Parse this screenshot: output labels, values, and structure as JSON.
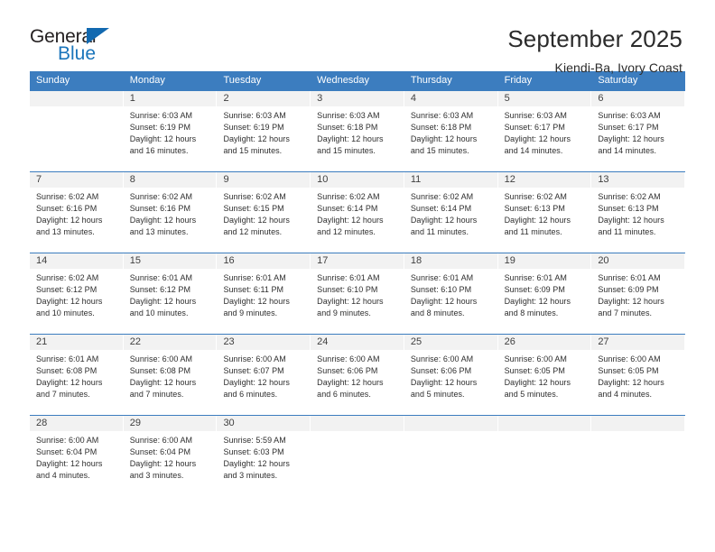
{
  "brand": {
    "name_part1": "General",
    "name_part2": "Blue",
    "triangle_icon": "triangle-icon",
    "accent_color": "#1b75bb"
  },
  "header": {
    "title": "September 2025",
    "subtitle": "Kiendi-Ba, Ivory Coast"
  },
  "theme": {
    "header_row_bg": "#3c7dbf",
    "daynum_band_bg": "#f2f2f2",
    "grid_line": "#3c7dbf",
    "text": "#2e2e2e"
  },
  "calendar": {
    "day_headers": [
      "Sunday",
      "Monday",
      "Tuesday",
      "Wednesday",
      "Thursday",
      "Friday",
      "Saturday"
    ],
    "weeks": [
      [
        {
          "day": "",
          "lines": []
        },
        {
          "day": "1",
          "lines": [
            "Sunrise: 6:03 AM",
            "Sunset: 6:19 PM",
            "Daylight: 12 hours",
            "and 16 minutes."
          ]
        },
        {
          "day": "2",
          "lines": [
            "Sunrise: 6:03 AM",
            "Sunset: 6:19 PM",
            "Daylight: 12 hours",
            "and 15 minutes."
          ]
        },
        {
          "day": "3",
          "lines": [
            "Sunrise: 6:03 AM",
            "Sunset: 6:18 PM",
            "Daylight: 12 hours",
            "and 15 minutes."
          ]
        },
        {
          "day": "4",
          "lines": [
            "Sunrise: 6:03 AM",
            "Sunset: 6:18 PM",
            "Daylight: 12 hours",
            "and 15 minutes."
          ]
        },
        {
          "day": "5",
          "lines": [
            "Sunrise: 6:03 AM",
            "Sunset: 6:17 PM",
            "Daylight: 12 hours",
            "and 14 minutes."
          ]
        },
        {
          "day": "6",
          "lines": [
            "Sunrise: 6:03 AM",
            "Sunset: 6:17 PM",
            "Daylight: 12 hours",
            "and 14 minutes."
          ]
        }
      ],
      [
        {
          "day": "7",
          "lines": [
            "Sunrise: 6:02 AM",
            "Sunset: 6:16 PM",
            "Daylight: 12 hours",
            "and 13 minutes."
          ]
        },
        {
          "day": "8",
          "lines": [
            "Sunrise: 6:02 AM",
            "Sunset: 6:16 PM",
            "Daylight: 12 hours",
            "and 13 minutes."
          ]
        },
        {
          "day": "9",
          "lines": [
            "Sunrise: 6:02 AM",
            "Sunset: 6:15 PM",
            "Daylight: 12 hours",
            "and 12 minutes."
          ]
        },
        {
          "day": "10",
          "lines": [
            "Sunrise: 6:02 AM",
            "Sunset: 6:14 PM",
            "Daylight: 12 hours",
            "and 12 minutes."
          ]
        },
        {
          "day": "11",
          "lines": [
            "Sunrise: 6:02 AM",
            "Sunset: 6:14 PM",
            "Daylight: 12 hours",
            "and 11 minutes."
          ]
        },
        {
          "day": "12",
          "lines": [
            "Sunrise: 6:02 AM",
            "Sunset: 6:13 PM",
            "Daylight: 12 hours",
            "and 11 minutes."
          ]
        },
        {
          "day": "13",
          "lines": [
            "Sunrise: 6:02 AM",
            "Sunset: 6:13 PM",
            "Daylight: 12 hours",
            "and 11 minutes."
          ]
        }
      ],
      [
        {
          "day": "14",
          "lines": [
            "Sunrise: 6:02 AM",
            "Sunset: 6:12 PM",
            "Daylight: 12 hours",
            "and 10 minutes."
          ]
        },
        {
          "day": "15",
          "lines": [
            "Sunrise: 6:01 AM",
            "Sunset: 6:12 PM",
            "Daylight: 12 hours",
            "and 10 minutes."
          ]
        },
        {
          "day": "16",
          "lines": [
            "Sunrise: 6:01 AM",
            "Sunset: 6:11 PM",
            "Daylight: 12 hours",
            "and 9 minutes."
          ]
        },
        {
          "day": "17",
          "lines": [
            "Sunrise: 6:01 AM",
            "Sunset: 6:10 PM",
            "Daylight: 12 hours",
            "and 9 minutes."
          ]
        },
        {
          "day": "18",
          "lines": [
            "Sunrise: 6:01 AM",
            "Sunset: 6:10 PM",
            "Daylight: 12 hours",
            "and 8 minutes."
          ]
        },
        {
          "day": "19",
          "lines": [
            "Sunrise: 6:01 AM",
            "Sunset: 6:09 PM",
            "Daylight: 12 hours",
            "and 8 minutes."
          ]
        },
        {
          "day": "20",
          "lines": [
            "Sunrise: 6:01 AM",
            "Sunset: 6:09 PM",
            "Daylight: 12 hours",
            "and 7 minutes."
          ]
        }
      ],
      [
        {
          "day": "21",
          "lines": [
            "Sunrise: 6:01 AM",
            "Sunset: 6:08 PM",
            "Daylight: 12 hours",
            "and 7 minutes."
          ]
        },
        {
          "day": "22",
          "lines": [
            "Sunrise: 6:00 AM",
            "Sunset: 6:08 PM",
            "Daylight: 12 hours",
            "and 7 minutes."
          ]
        },
        {
          "day": "23",
          "lines": [
            "Sunrise: 6:00 AM",
            "Sunset: 6:07 PM",
            "Daylight: 12 hours",
            "and 6 minutes."
          ]
        },
        {
          "day": "24",
          "lines": [
            "Sunrise: 6:00 AM",
            "Sunset: 6:06 PM",
            "Daylight: 12 hours",
            "and 6 minutes."
          ]
        },
        {
          "day": "25",
          "lines": [
            "Sunrise: 6:00 AM",
            "Sunset: 6:06 PM",
            "Daylight: 12 hours",
            "and 5 minutes."
          ]
        },
        {
          "day": "26",
          "lines": [
            "Sunrise: 6:00 AM",
            "Sunset: 6:05 PM",
            "Daylight: 12 hours",
            "and 5 minutes."
          ]
        },
        {
          "day": "27",
          "lines": [
            "Sunrise: 6:00 AM",
            "Sunset: 6:05 PM",
            "Daylight: 12 hours",
            "and 4 minutes."
          ]
        }
      ],
      [
        {
          "day": "28",
          "lines": [
            "Sunrise: 6:00 AM",
            "Sunset: 6:04 PM",
            "Daylight: 12 hours",
            "and 4 minutes."
          ]
        },
        {
          "day": "29",
          "lines": [
            "Sunrise: 6:00 AM",
            "Sunset: 6:04 PM",
            "Daylight: 12 hours",
            "and 3 minutes."
          ]
        },
        {
          "day": "30",
          "lines": [
            "Sunrise: 5:59 AM",
            "Sunset: 6:03 PM",
            "Daylight: 12 hours",
            "and 3 minutes."
          ]
        },
        {
          "day": "",
          "lines": []
        },
        {
          "day": "",
          "lines": []
        },
        {
          "day": "",
          "lines": []
        },
        {
          "day": "",
          "lines": []
        }
      ]
    ]
  }
}
